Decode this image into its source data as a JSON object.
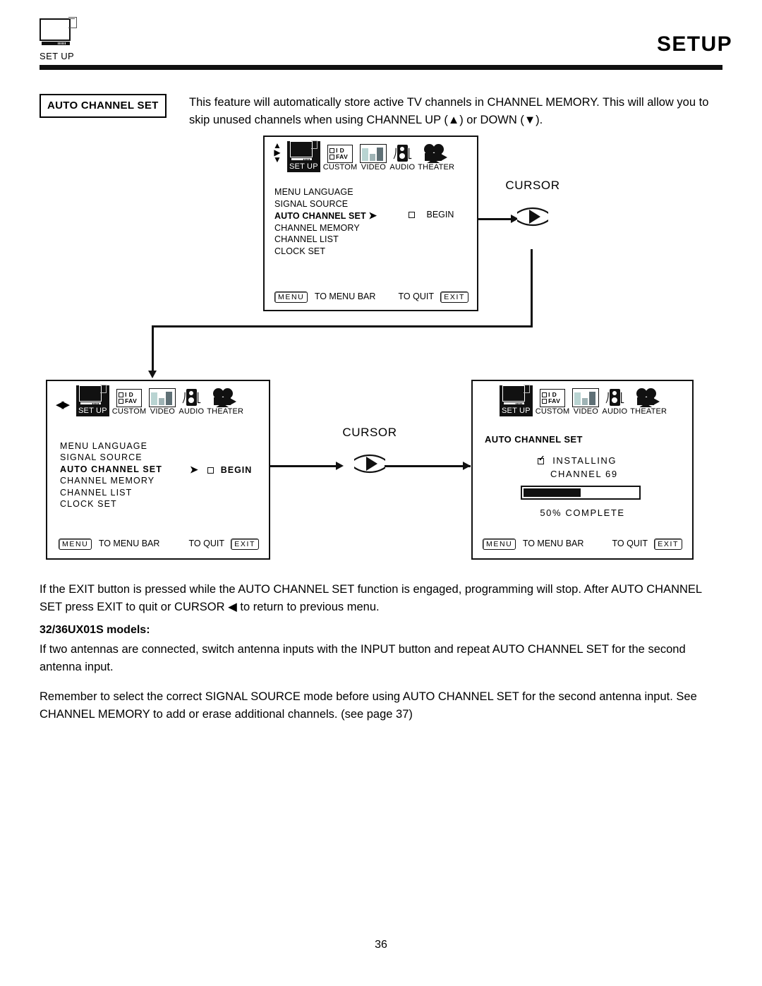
{
  "header": {
    "icon_label": "SET UP",
    "title": "SETUP"
  },
  "intro": {
    "badge": "AUTO CHANNEL SET",
    "text": "This feature will automatically store active TV channels in CHANNEL MEMORY.  This will allow you to skip unused channels when using CHANNEL UP (▲) or DOWN (▼)."
  },
  "icon_bar": {
    "items": [
      {
        "label": "SET UP",
        "icon": "tv-setup-icon",
        "selected": true
      },
      {
        "label": "CUSTOM",
        "icon": "custom-id-fav-icon",
        "selected": false
      },
      {
        "label": "VIDEO",
        "icon": "video-bars-icon",
        "selected": false
      },
      {
        "label": "AUDIO",
        "icon": "speaker-icon",
        "selected": false
      },
      {
        "label": "THEATER",
        "icon": "movie-camera-icon",
        "selected": false
      }
    ],
    "custom_row1": "I D",
    "custom_row2": "FAV"
  },
  "menu": {
    "items": [
      "MENU LANGUAGE",
      "SIGNAL SOURCE",
      "AUTO CHANNEL SET",
      "CHANNEL MEMORY",
      "CHANNEL LIST",
      "CLOCK SET"
    ],
    "active_index": 2,
    "begin_label": "BEGIN"
  },
  "footer_bar": {
    "menu_key": "MENU",
    "menu_text": "TO MENU BAR",
    "quit_text": "TO QUIT",
    "exit_key": "EXIT"
  },
  "cursor_top": {
    "title": "CURSOR",
    "icon": "cursor-right-button-icon"
  },
  "cursor_mid": {
    "title": "CURSOR",
    "icon": "cursor-right-button-icon"
  },
  "progress_panel": {
    "heading": "AUTO CHANNEL SET",
    "installing_label": "INSTALLING",
    "channel_label": "CHANNEL  69",
    "percent_label": "50% COMPLETE",
    "percent_value": 50
  },
  "body": {
    "p1": "If the EXIT button is pressed while the AUTO CHANNEL SET function is engaged, programming will stop. After AUTO CHANNEL SET press EXIT to quit or CURSOR ◀ to return to previous menu.",
    "models_heading": "32/36UX01S models:",
    "p2": "If two antennas are connected, switch antenna inputs with the INPUT button and repeat AUTO CHANNEL SET for the second antenna input.",
    "p3": "Remember to select the correct SIGNAL SOURCE mode before using AUTO CHANNEL SET for the second antenna input. See CHANNEL MEMORY to add or erase additional channels. (see page 37)"
  },
  "page_number": "36"
}
